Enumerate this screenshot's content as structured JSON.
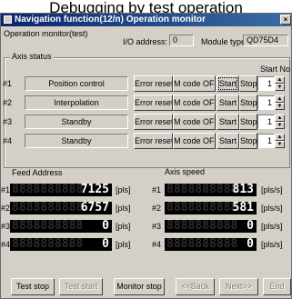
{
  "page_caption": "Debugging by test operation",
  "window": {
    "title": "Navigation function(12/n) Operation monitor",
    "close_glyph": "×"
  },
  "header": {
    "monitor_label": "Operation monitor(test)",
    "io_label": "I/O address:",
    "io_value": "0",
    "module_label": "Module type:",
    "module_value": "QD75D4"
  },
  "axis_status": {
    "group_title": "Axis status",
    "start_no_label": "Start No.",
    "error_reset_label": "Error reset",
    "mcode_off_label": "M code OFF",
    "start_label": "Start",
    "stop_label": "Stop",
    "rows": [
      {
        "num": "#1",
        "status": "Position control",
        "start_no": "1"
      },
      {
        "num": "#2",
        "status": "Interpolation",
        "start_no": "1"
      },
      {
        "num": "#3",
        "status": "Standby",
        "start_no": "1"
      },
      {
        "num": "#4",
        "status": "Standby",
        "start_no": "1"
      }
    ]
  },
  "feed": {
    "title": "Feed Address",
    "unit": "[pls]",
    "ghost": "8888888888",
    "rows": [
      {
        "num": "#1",
        "value": "7125"
      },
      {
        "num": "#2",
        "value": "6757"
      },
      {
        "num": "#3",
        "value": "0"
      },
      {
        "num": "#4",
        "value": "0"
      }
    ]
  },
  "speed": {
    "title": "Axis speed",
    "unit": "[pls/s]",
    "ghost": "8888888888",
    "rows": [
      {
        "num": "#1",
        "value": "813"
      },
      {
        "num": "#2",
        "value": "581"
      },
      {
        "num": "#3",
        "value": "0"
      },
      {
        "num": "#4",
        "value": "0"
      }
    ]
  },
  "footer": {
    "test_stop": "Test stop",
    "test_start": "Test start",
    "monitor_stop": "Monitor stop",
    "back": "<<Back",
    "next": "Next>>",
    "end": "End"
  }
}
